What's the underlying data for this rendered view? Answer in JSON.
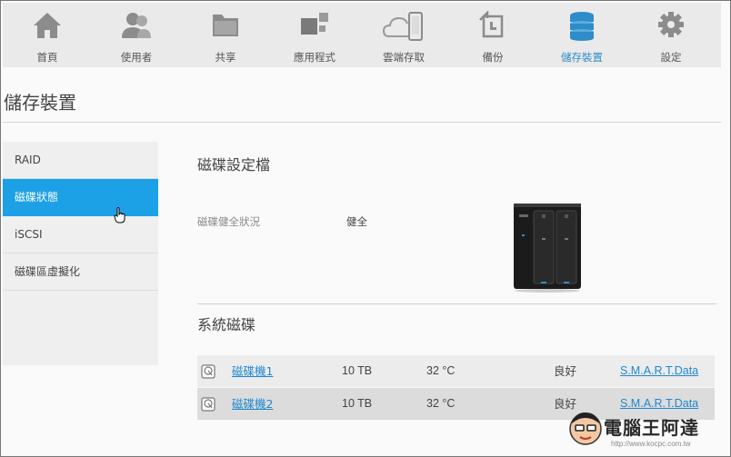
{
  "nav": {
    "items": [
      {
        "label": "首頁",
        "icon": "home-icon"
      },
      {
        "label": "使用者",
        "icon": "users-icon"
      },
      {
        "label": "共享",
        "icon": "folder-icon"
      },
      {
        "label": "應用程式",
        "icon": "apps-icon"
      },
      {
        "label": "雲端存取",
        "icon": "cloud-phone-icon"
      },
      {
        "label": "備份",
        "icon": "backup-icon"
      },
      {
        "label": "儲存裝置",
        "icon": "database-icon",
        "active": true
      },
      {
        "label": "設定",
        "icon": "gear-icon"
      }
    ],
    "active_color": "#2e8cc8"
  },
  "page": {
    "title": "儲存裝置"
  },
  "sidebar": {
    "items": [
      {
        "label": "RAID"
      },
      {
        "label": "磁碟狀態",
        "active": true
      },
      {
        "label": "iSCSI"
      },
      {
        "label": "磁碟區虛擬化"
      }
    ],
    "active_color": "#1da1e6"
  },
  "profile": {
    "heading": "磁碟設定檔",
    "health_label": "磁碟健全狀況",
    "health_value": "健全"
  },
  "system_disks": {
    "heading": "系統磁碟",
    "rows": [
      {
        "name": "磁碟機1",
        "capacity": "10 TB",
        "temp": "32 °C",
        "status": "良好",
        "smart": "S.M.A.R.T.Data"
      },
      {
        "name": "磁碟機2",
        "capacity": "10 TB",
        "temp": "32 °C",
        "status": "良好",
        "smart": "S.M.A.R.T.Data"
      }
    ]
  },
  "watermark": {
    "text": "電腦王阿達",
    "url": "http://www.kocpc.com.tw"
  }
}
